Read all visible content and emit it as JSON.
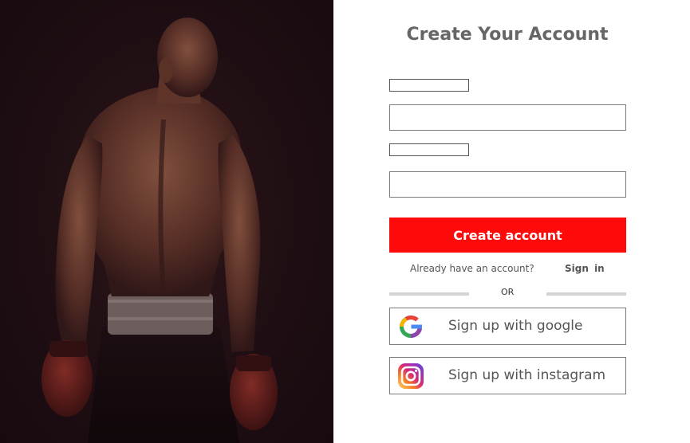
{
  "hero": {
    "image": "boxer-back-view-photo"
  },
  "form": {
    "title": "Create Your Account",
    "field1_label": "",
    "field1_value": "",
    "field2_label": "",
    "field2_value": "",
    "create_button": "Create account",
    "already_text": "Already have an account?",
    "signin_link": "Sign in",
    "or_text": "OR",
    "google_button": "Sign up with google",
    "instagram_button": "Sign up with instagram"
  },
  "colors": {
    "accent": "#ff0a0a",
    "title": "#666666",
    "muted_text": "#555555",
    "divider": "#d4d4d4"
  },
  "icons": [
    "google-icon",
    "instagram-icon"
  ]
}
